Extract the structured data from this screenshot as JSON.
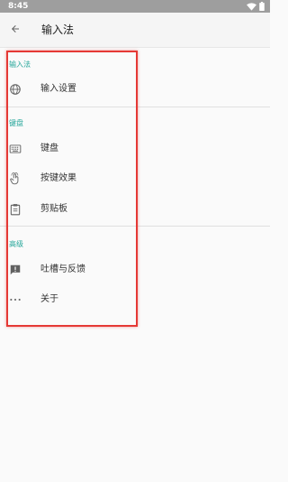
{
  "status_bar": {
    "time": "8:45",
    "icons": [
      "wifi-icon",
      "battery-icon"
    ]
  },
  "app_bar": {
    "title": "输入法",
    "back_icon": "arrow-left-icon"
  },
  "sections": [
    {
      "header": "输入法",
      "items": [
        {
          "label": "输入设置",
          "icon": "globe-icon"
        }
      ]
    },
    {
      "header": "键盘",
      "items": [
        {
          "label": "键盘",
          "icon": "keyboard-icon"
        },
        {
          "label": "按键效果",
          "icon": "touch-icon"
        },
        {
          "label": "剪贴板",
          "icon": "clipboard-icon"
        }
      ]
    },
    {
      "header": "高级",
      "items": [
        {
          "label": "吐槽与反馈",
          "icon": "feedback-icon"
        },
        {
          "label": "关于",
          "icon": "more-horiz-icon"
        }
      ]
    }
  ],
  "colors": {
    "accent": "#26a69a",
    "highlight_box": "#e53935",
    "status_bar": "#9e9e9e"
  }
}
